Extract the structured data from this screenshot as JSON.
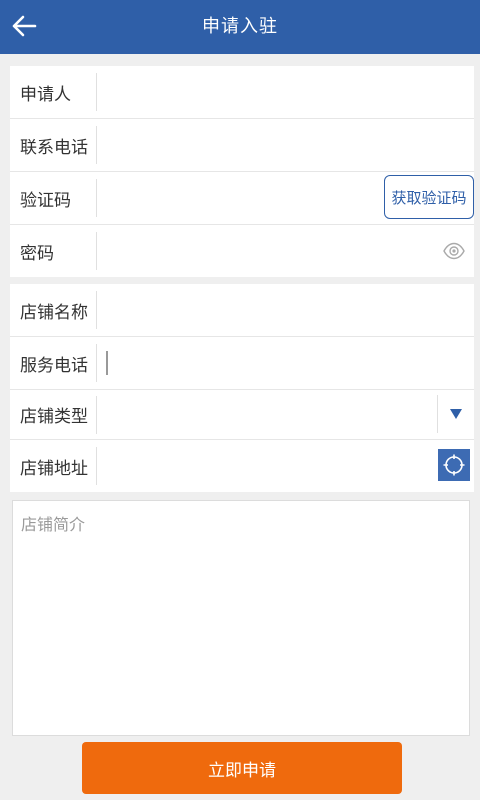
{
  "header": {
    "title": "申请入驻",
    "back_icon": "arrow-left-icon",
    "bg_color": "#2f5fa8"
  },
  "account": {
    "applicant_label": "申请人",
    "applicant_value": "",
    "phone_label": "联系电话",
    "phone_value": "",
    "code_label": "验证码",
    "code_value": "",
    "get_code_label": "获取验证码",
    "password_label": "密码",
    "password_value": "",
    "eye_icon": "eye-icon"
  },
  "shop": {
    "name_label": "店铺名称",
    "name_value": "",
    "service_phone_label": "服务电话",
    "service_phone_value": "",
    "type_label": "店铺类型",
    "type_value": "",
    "dropdown_icon": "triangle-down-icon",
    "address_label": "店铺地址",
    "address_value": "",
    "locate_icon": "crosshair-icon"
  },
  "intro": {
    "placeholder": "店铺简介",
    "value": ""
  },
  "submit": {
    "label": "立即申请",
    "color": "#ef6a0d"
  }
}
